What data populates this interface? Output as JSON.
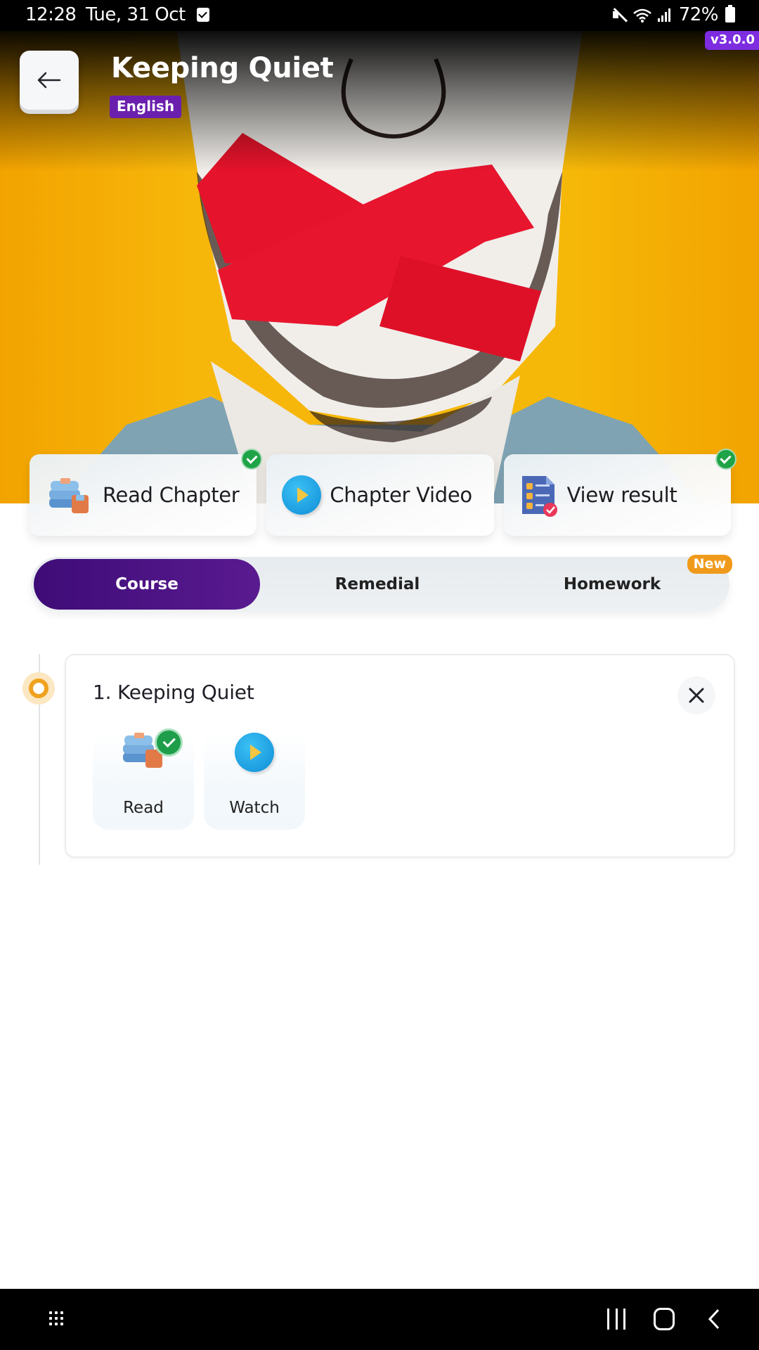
{
  "status_bar": {
    "time": "12:28",
    "date": "Tue, 31 Oct",
    "battery": "72%",
    "icons": [
      "checkbox-notification-icon",
      "mute-icon",
      "wifi-icon",
      "signal-icon",
      "battery-icon"
    ]
  },
  "app": {
    "version": "v3.0.0"
  },
  "header": {
    "back_icon": "arrow-left-icon",
    "title": "Keeping Quiet",
    "language": "English"
  },
  "hero": {
    "image": "man-with-taped-mouth-illustration",
    "colors": {
      "background": "#f6b808",
      "tape": "#e5132b"
    }
  },
  "actions": [
    {
      "label": "Read Chapter",
      "icon": "books-icon",
      "completed": true
    },
    {
      "label": "Chapter Video",
      "icon": "play-icon",
      "completed": false
    },
    {
      "label": "View result",
      "icon": "result-document-icon",
      "completed": true
    }
  ],
  "tabs": [
    {
      "label": "Course",
      "active": true
    },
    {
      "label": "Remedial",
      "active": false
    },
    {
      "label": "Homework",
      "active": false,
      "badge": "New"
    }
  ],
  "chapters": [
    {
      "title": "1. Keeping Quiet",
      "close_icon": "close-icon",
      "resources": [
        {
          "label": "Read",
          "icon": "books-icon",
          "completed": true
        },
        {
          "label": "Watch",
          "icon": "play-icon",
          "completed": false
        }
      ]
    }
  ],
  "colors": {
    "primary": "#4a1384",
    "accent_badge": "#6a1fae",
    "version_badge": "#7d2ce0",
    "success": "#1ea347",
    "new_badge": "#f09a1b",
    "timeline": "#f0a21e"
  },
  "nav_bar": {
    "icons": [
      "app-drawer-icon",
      "recents-icon",
      "home-icon",
      "back-icon"
    ]
  }
}
